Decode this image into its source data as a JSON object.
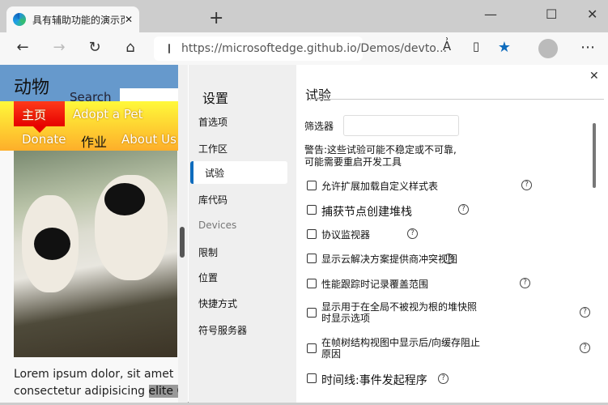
{
  "browser": {
    "tab_title": "具有辅助功能的演示页为",
    "url": "https://microsoftedge.github.io/Demos/devto...",
    "new_tab": "+"
  },
  "page": {
    "heading": "动物",
    "search_label": "Search",
    "nav": [
      "主页",
      "Adopt a Pet",
      "Donate",
      "作业",
      "About Us"
    ],
    "lorem_line1": "Lorem ipsum dolor, sit amet",
    "lorem_line2": "consectetur adipisicing ",
    "lorem_sel": "elite Co"
  },
  "settings": {
    "title": "设置",
    "items": [
      "首选项",
      "工作区",
      "试验",
      "库代码",
      "Devices",
      "限制",
      "位置",
      "快捷方式",
      "符号服务器"
    ],
    "active": "试验"
  },
  "experiments": {
    "title": "试验",
    "filter_label": "筛选器",
    "filter_value": "",
    "warning": "警告:这些试验可能不稳定或不可靠,\n可能需要重启开发工具",
    "items": [
      {
        "label": "允许扩展加载自定义样式表",
        "checked": false
      },
      {
        "label": "捕获节点创建堆栈",
        "checked": false
      },
      {
        "label": "协议监视器",
        "checked": false
      },
      {
        "label": "显示云解决方案提供商冲突视图",
        "checked": false
      },
      {
        "label": "性能跟踪时记录覆盖范围",
        "checked": false
      },
      {
        "label": "显示用于在全局不被视为根的堆快照时显示选项",
        "checked": false
      },
      {
        "label": "在帧树结构视图中显示后/向缓存阻止原因",
        "checked": false
      },
      {
        "label": "时间线:事件发起程序",
        "checked": false
      }
    ]
  }
}
